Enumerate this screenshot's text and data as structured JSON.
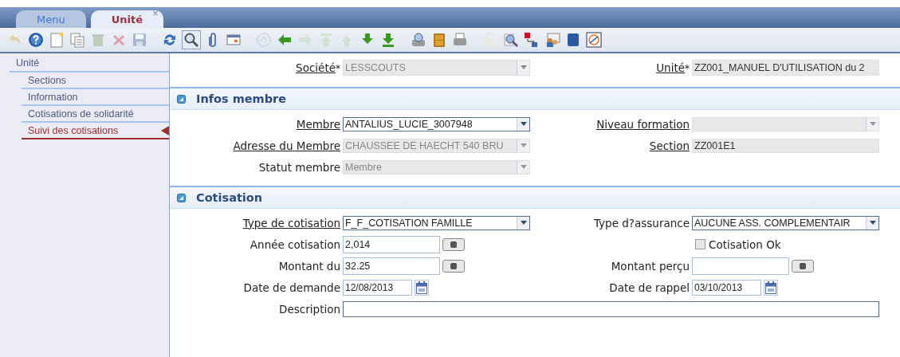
{
  "tabs": [
    {
      "label": "Menu",
      "selected": false
    },
    {
      "label": "Unité",
      "selected": true,
      "close": "×"
    }
  ],
  "toolbar": [
    {
      "disabled": true
    },
    {
      "disabled": false
    },
    {
      "disabled": false
    },
    {
      "disabled": false
    },
    {
      "disabled": true
    },
    {
      "disabled": true
    },
    {
      "disabled": true
    },
    {
      "disabled": false
    },
    {
      "disabled": false,
      "pressed": true
    },
    {
      "disabled": false
    },
    {
      "disabled": false
    },
    {
      "disabled": true
    },
    {
      "disabled": false
    },
    {
      "disabled": true
    },
    {
      "disabled": true
    },
    {
      "disabled": true
    },
    {
      "disabled": false
    },
    {
      "disabled": false
    },
    {
      "disabled": false
    },
    {
      "disabled": false
    },
    {
      "disabled": false
    },
    {
      "disabled": true
    },
    {
      "disabled": false
    },
    {
      "disabled": false
    },
    {
      "disabled": false
    },
    {
      "disabled": false
    },
    {
      "disabled": false
    }
  ],
  "sidebar": {
    "title": "Unité",
    "items": [
      {
        "label": "Sections",
        "selected": false
      },
      {
        "label": "Information",
        "selected": false
      },
      {
        "label": "Cotisations de solidarité",
        "selected": false
      },
      {
        "label": "Suivi des cotisations",
        "selected": true
      }
    ]
  },
  "header": {
    "left": {
      "label": "Société",
      "mark": "*",
      "link": true,
      "kind": "select",
      "value": "LESSCOUTS",
      "disabled": true
    },
    "right": {
      "label": "Unité",
      "mark": "*",
      "link": true,
      "kind": "text",
      "value": "ZZ001_MANUEL D'UTILISATION du 2",
      "disabled": true
    }
  },
  "sections": [
    {
      "title": "Infos membre",
      "expanded": true,
      "rows": [
        {
          "left": {
            "label": "Membre",
            "link": true,
            "kind": "select",
            "value": "ANTALIUS_LUCIE_3007948",
            "disabled": false
          },
          "right": {
            "label": "Niveau formation",
            "link": true,
            "kind": "select",
            "disabled": true
          }
        },
        {
          "left": {
            "label": "Adresse du Membre",
            "link": true,
            "kind": "select",
            "value": "CHAUSSEE DE HAECHT 540  BRU",
            "disabled": true
          },
          "right": {
            "label": "Section",
            "link": true,
            "kind": "text",
            "value": "ZZ001E1",
            "disabled": true
          }
        },
        {
          "left": {
            "label": "Statut membre",
            "link": false,
            "kind": "select",
            "value": "Membre",
            "disabled": true
          }
        }
      ]
    },
    {
      "title": "Cotisation",
      "expanded": true,
      "rows": [
        {
          "left": {
            "label": "Type de cotisation",
            "link": true,
            "kind": "select",
            "value": "F_F_COTISATION FAMILLE",
            "disabled": false
          },
          "right": {
            "label": "Type d?assurance",
            "link": false,
            "kind": "select",
            "value": "AUCUNE ASS. COMPLEMENTAIR",
            "disabled": false
          }
        },
        {
          "left": {
            "label": "Année cotisation",
            "link": false,
            "kind": "number",
            "value": "2,014",
            "disabled": false
          },
          "right": {
            "label": "Cotisation Ok",
            "kind": "checkbox",
            "checked": false
          }
        },
        {
          "left": {
            "label": "Montant du",
            "link": false,
            "kind": "number",
            "value": "32.25",
            "disabled": false
          },
          "right": {
            "label": "Montant perçu",
            "link": false,
            "kind": "number",
            "disabled": false
          }
        },
        {
          "left": {
            "label": "Date de demande",
            "link": false,
            "kind": "date",
            "value": "12/08/2013",
            "disabled": false
          },
          "right": {
            "label": "Date de rappel",
            "link": false,
            "kind": "date",
            "value": "03/10/2013",
            "disabled": false
          }
        },
        {
          "left": {
            "label": "Description",
            "link": false,
            "kind": "wide",
            "disabled": false
          }
        }
      ]
    }
  ]
}
